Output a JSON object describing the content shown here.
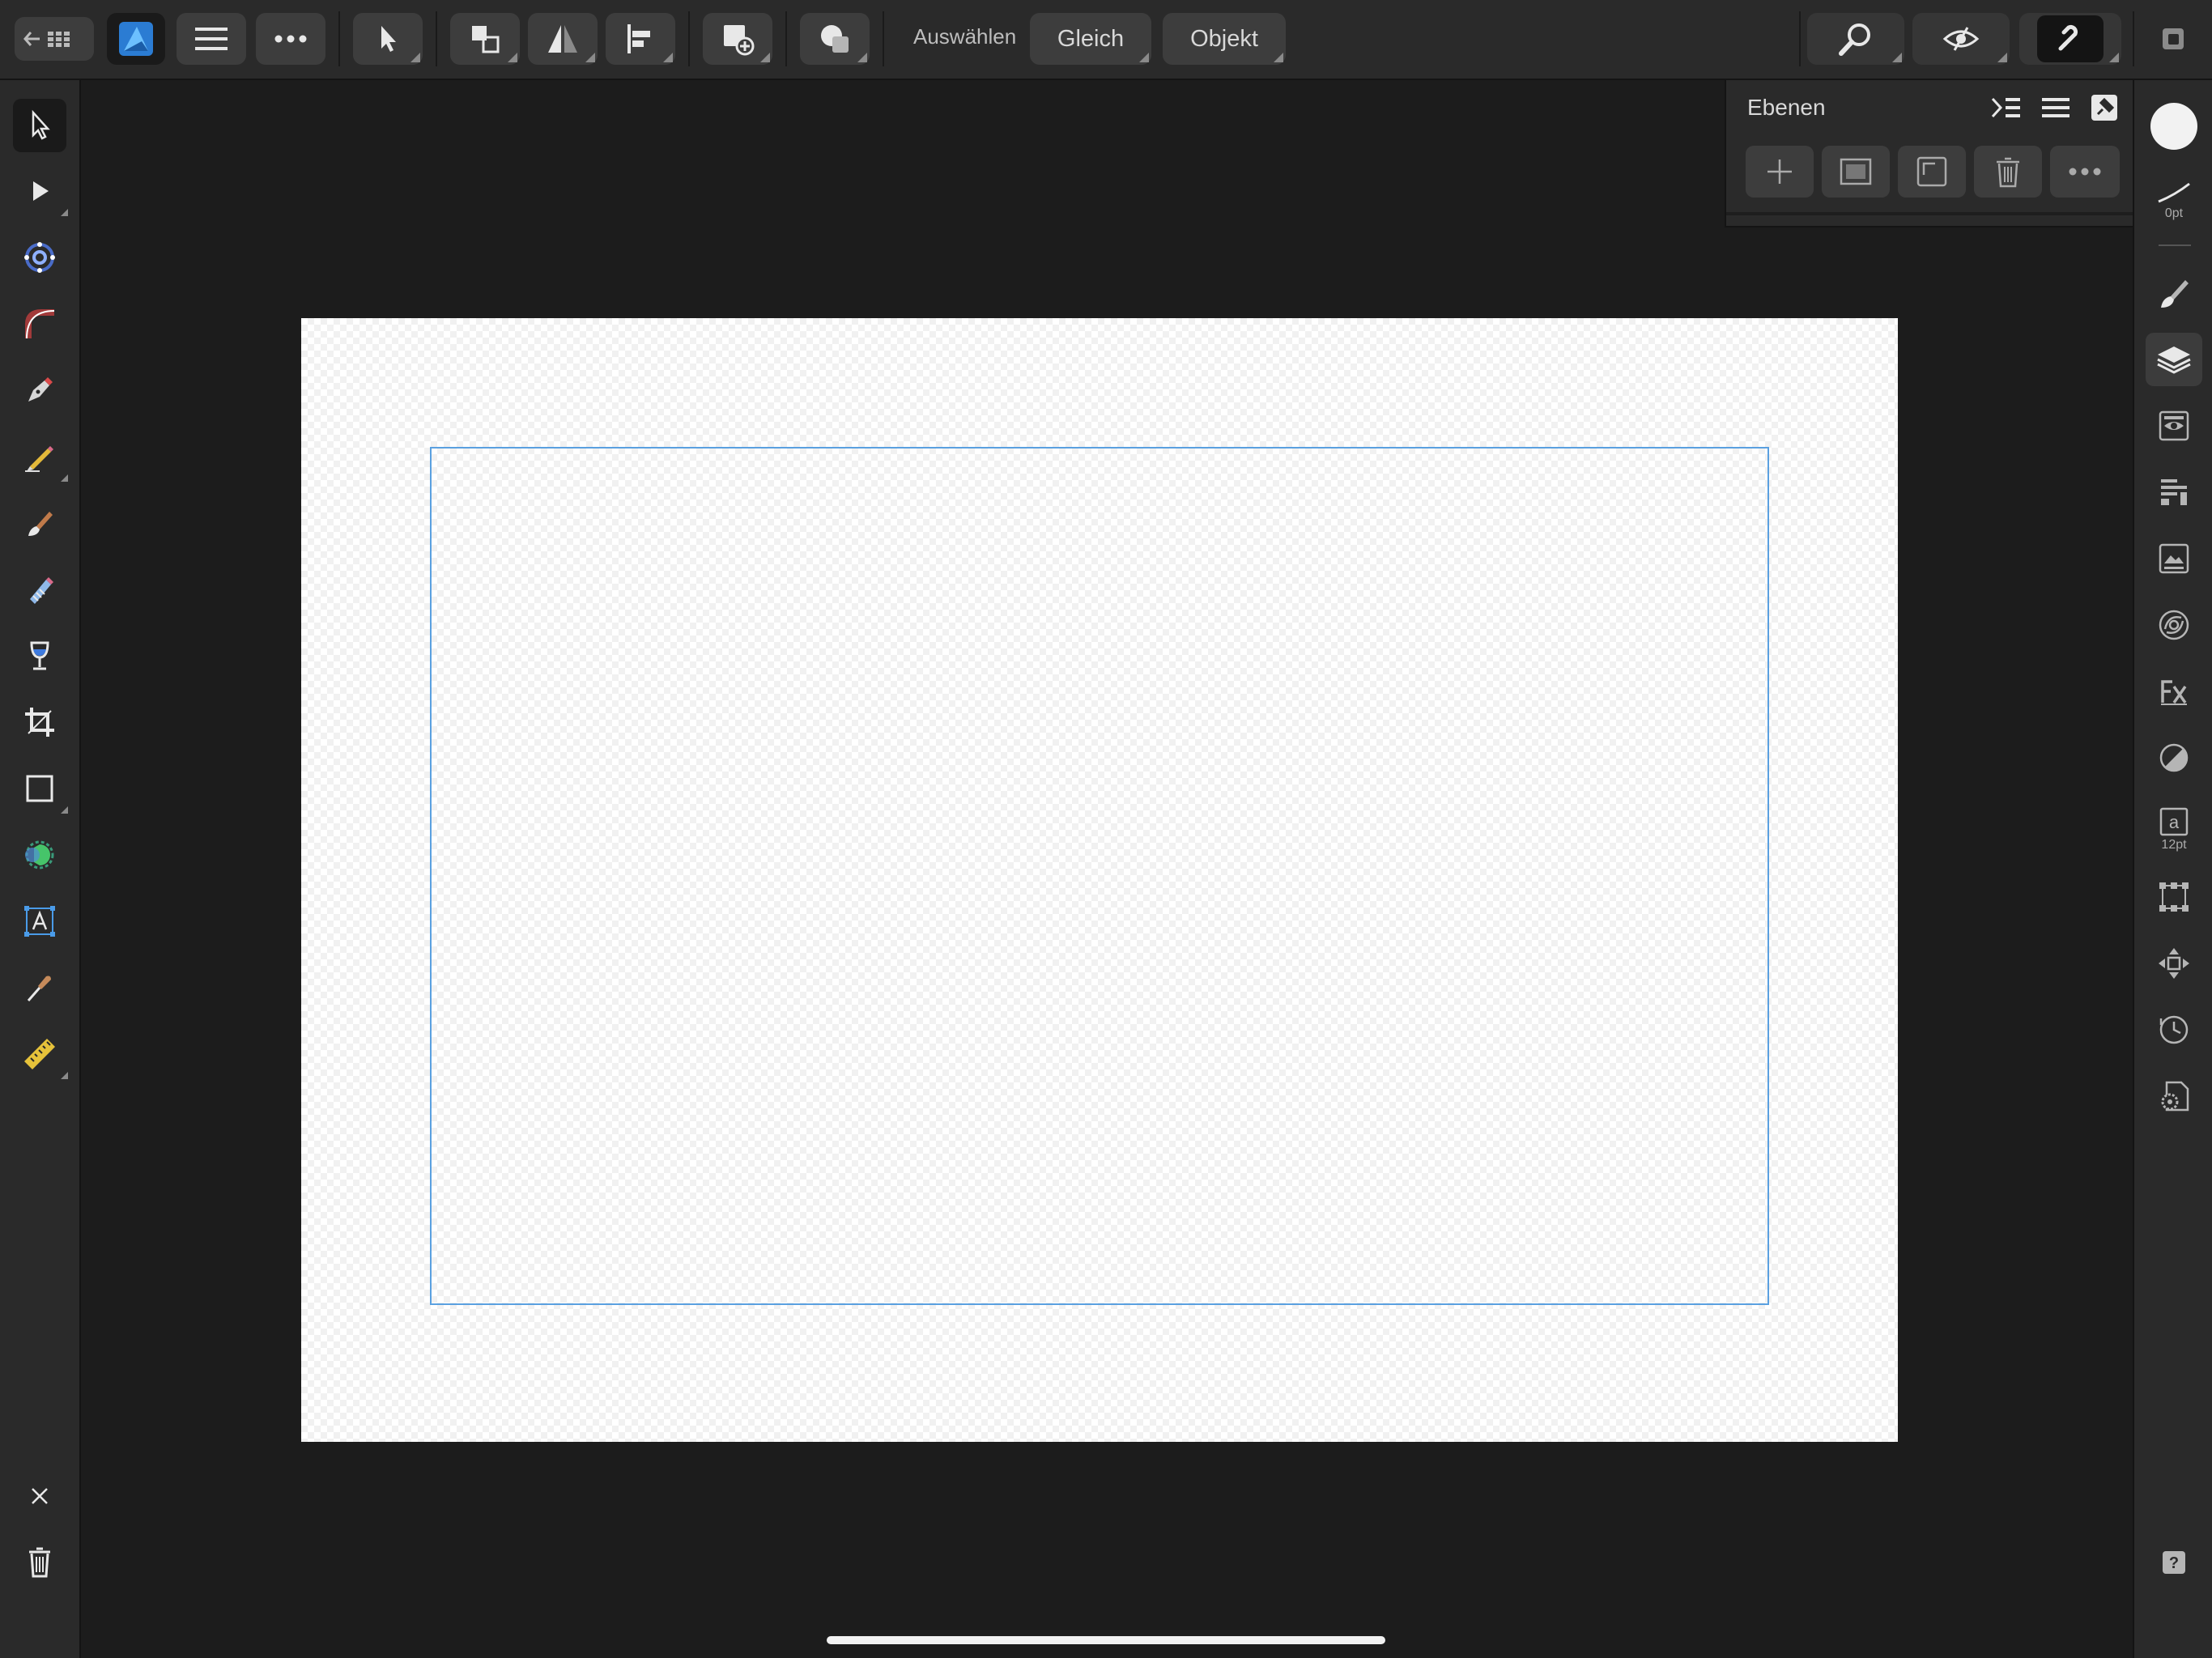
{
  "toolbar": {
    "select_label": "Auswählen",
    "same_button": "Gleich",
    "object_button": "Objekt",
    "icons": [
      "back-apps-icon",
      "affinity-designer-icon",
      "menu-icon",
      "more-icon",
      "move-tool-icon",
      "arrange-icon",
      "flip-icon",
      "align-icon",
      "add-shape-icon",
      "boolean-icon",
      "zoom-icon",
      "view-mode-icon",
      "snapping-icon",
      "window-icon"
    ]
  },
  "layers_panel": {
    "title": "Ebenen",
    "buttons": [
      "add-layer",
      "add-mask",
      "group",
      "delete",
      "more"
    ]
  },
  "right_bar": {
    "stroke_width": "0pt",
    "text_size": "12pt",
    "fill_color": "#f2f2f2"
  },
  "left_tools": [
    "move",
    "node",
    "contour",
    "corner",
    "pen",
    "pencil",
    "vector-brush",
    "fill",
    "transparency",
    "crop",
    "rectangle",
    "shape-builder",
    "artistic-text",
    "color-picker",
    "measure"
  ],
  "canvas": {
    "background": "#1c1c1c",
    "artboard_color": "#ffffff",
    "selection_color": "#5aa0e0"
  }
}
